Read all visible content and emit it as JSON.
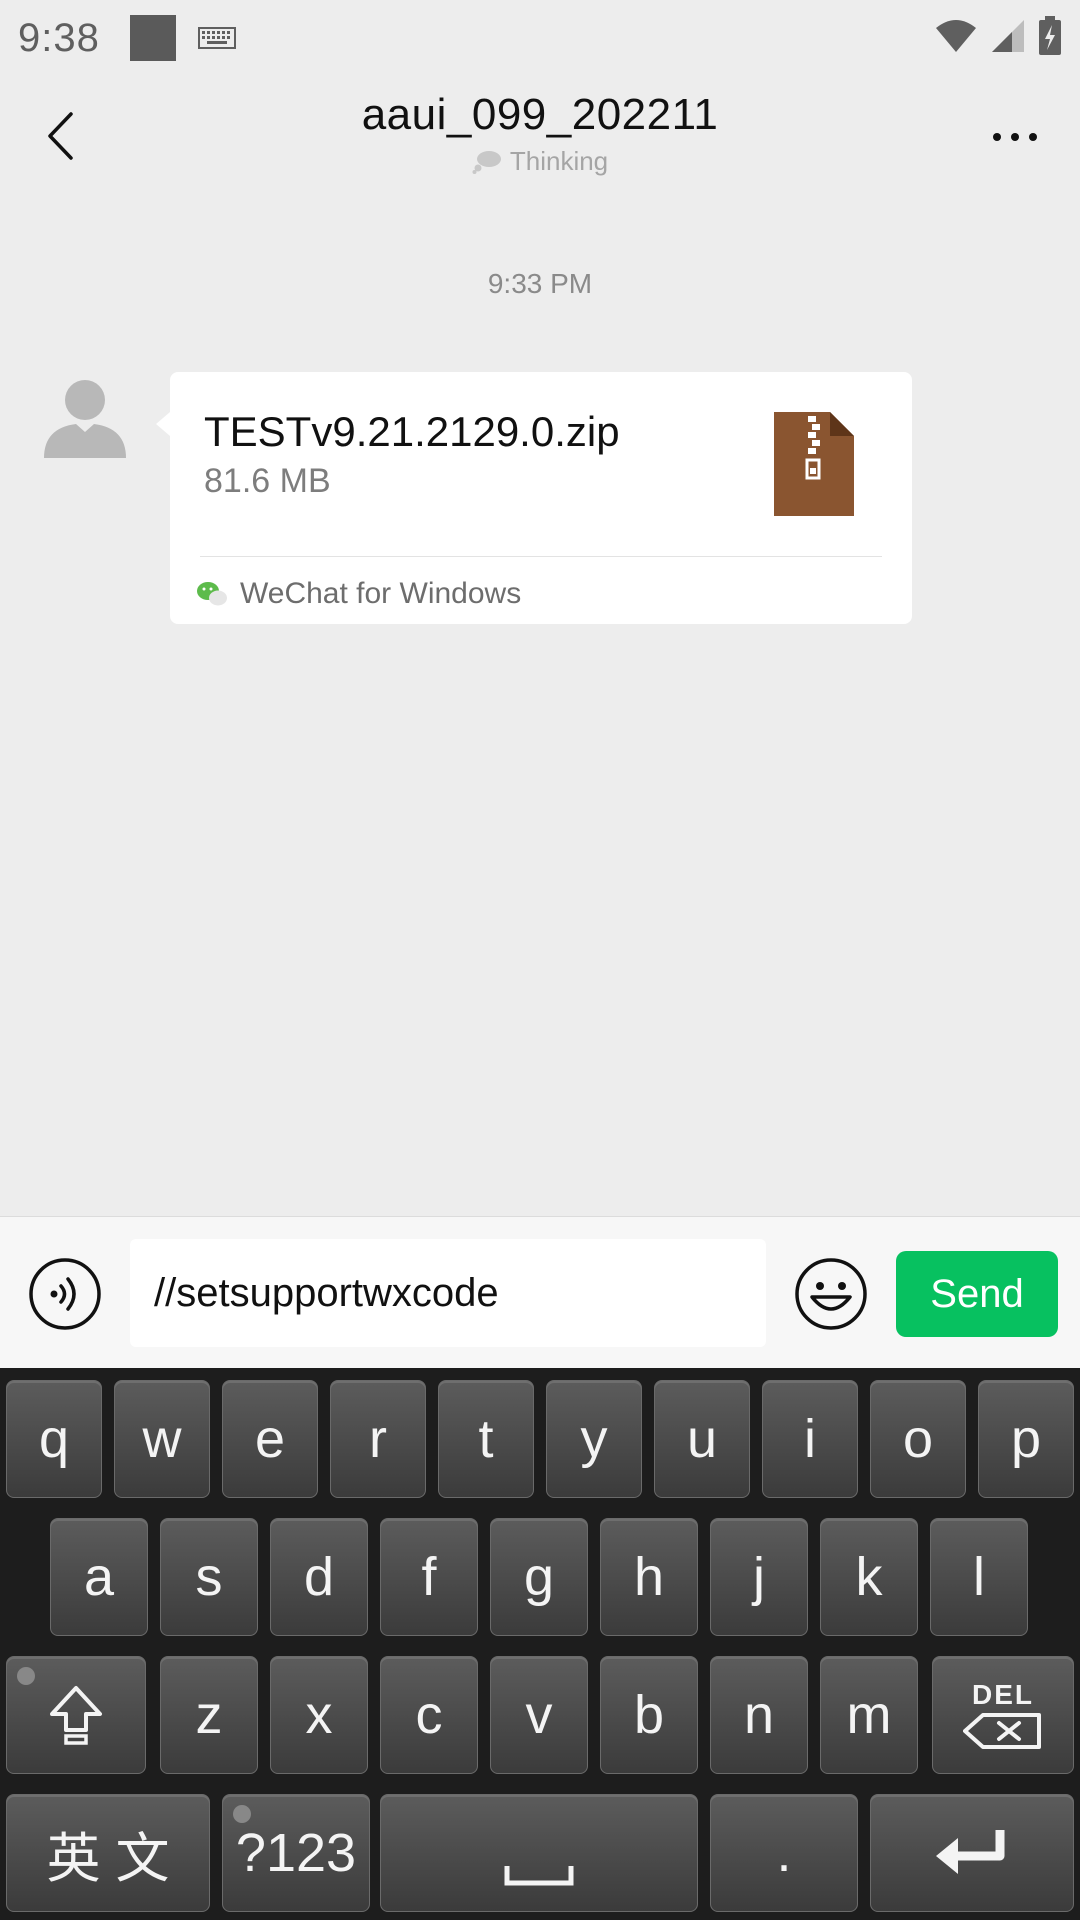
{
  "status_bar": {
    "time": "9:38"
  },
  "header": {
    "title": "aaui_099_202211",
    "subtitle": "Thinking"
  },
  "chat": {
    "timestamp": "9:33 PM",
    "message": {
      "file_name": "TESTv9.21.2129.0.zip",
      "file_size": "81.6 MB",
      "source": "WeChat for Windows"
    }
  },
  "input_bar": {
    "text_value": "//setsupportwxcode",
    "send_label": "Send"
  },
  "keyboard": {
    "row1": [
      "q",
      "w",
      "e",
      "r",
      "t",
      "y",
      "u",
      "i",
      "o",
      "p"
    ],
    "row2": [
      "a",
      "s",
      "d",
      "f",
      "g",
      "h",
      "j",
      "k",
      "l"
    ],
    "row3": [
      "z",
      "x",
      "c",
      "v",
      "b",
      "n",
      "m"
    ],
    "del_label": "DEL",
    "lang_label": "英 文",
    "symbols_label": "?123",
    "period_label": "."
  },
  "colors": {
    "accent": "#07c160",
    "zip_icon": "#8a5530",
    "background": "#ededed"
  }
}
